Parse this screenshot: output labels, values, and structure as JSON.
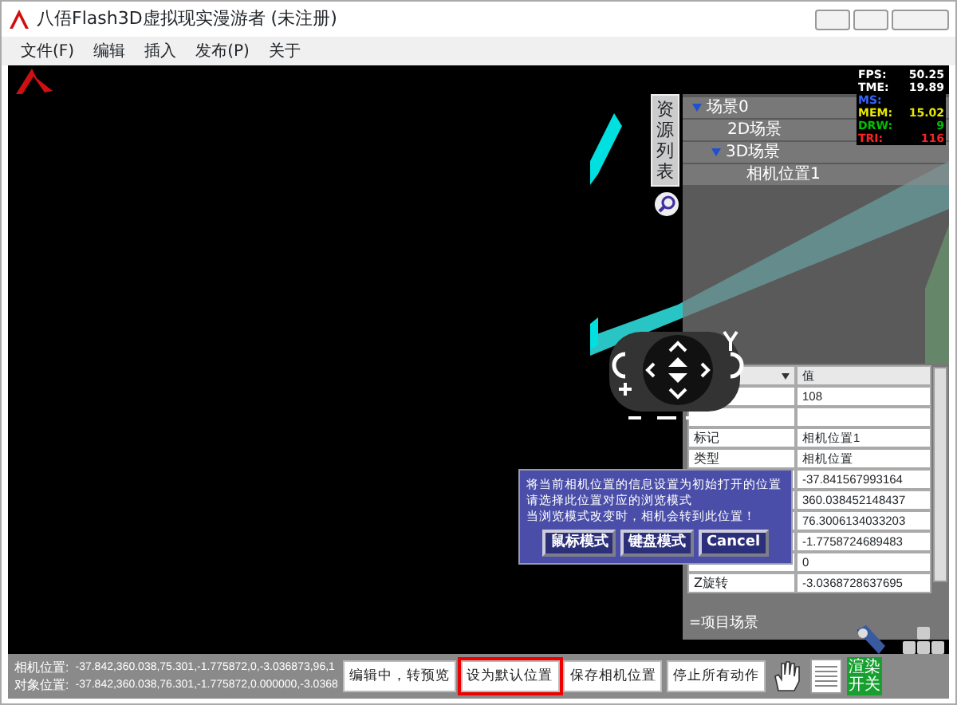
{
  "window": {
    "title": "八俉Flash3D虚拟现实漫游者 (未注册)"
  },
  "menu": [
    "文件(F)",
    "编辑",
    "插入",
    "发布(P)",
    "关于"
  ],
  "stats": [
    {
      "label": "FPS:",
      "value": "50.25",
      "color": "#ffffff"
    },
    {
      "label": "TME:",
      "value": "19.89",
      "color": "#ffffff"
    },
    {
      "label": "MS:",
      "color": "#3366ff"
    },
    {
      "label": "MEM:",
      "value": "15.02",
      "color": "#e8e800"
    },
    {
      "label": "DRW:",
      "value": "9",
      "color": "#00c000"
    },
    {
      "label": "TRI:",
      "value": "116",
      "color": "#ff2020"
    }
  ],
  "resource_tab": "资源列表",
  "tree": [
    {
      "label": "场景0",
      "expanded": true,
      "children": [
        {
          "label": "2D场景"
        },
        {
          "label": "3D场景",
          "expanded": true,
          "children": [
            {
              "label": "相机位置1"
            }
          ]
        }
      ]
    }
  ],
  "properties": {
    "columns": [
      "",
      "值"
    ],
    "rows": [
      {
        "value": "108"
      },
      {},
      {
        "label": "标记",
        "value": "相机位置1"
      },
      {
        "label": "类型",
        "value": "相机位置"
      },
      {
        "value": "-37.841567993164"
      },
      {
        "value": "360.038452148437"
      },
      {
        "value": "76.3006134033203"
      },
      {
        "value": "-1.7758724689483"
      },
      {
        "value": "0"
      },
      {
        "label": "Z旋转",
        "value": "-3.0368728637695"
      }
    ],
    "footer": "=项目场景"
  },
  "dialog": {
    "lines": [
      "将当前相机位置的信息设置为初始打开的位置",
      "请选择此位置对应的浏览模式",
      "当浏览模式改变时，相机会转到此位置！"
    ],
    "buttons": [
      "鼠标模式",
      "键盘模式",
      "Cancel"
    ]
  },
  "positions": [
    {
      "label": "相机位置:",
      "value": "-37.842,360.038,75.301,-1.775872,0,-3.036873,96,1"
    },
    {
      "label": "对象位置:",
      "value": "-37.842,360.038,76.301,-1.775872,0.000000,-3.0368"
    }
  ],
  "buttons": [
    {
      "label": "编辑中，转预览",
      "selected": false
    },
    {
      "label": "设为默认位置",
      "selected": true
    },
    {
      "label": "保存相机位置",
      "selected": false
    },
    {
      "label": "停止所有动作",
      "selected": false
    }
  ],
  "render_switch": {
    "label": "渲染开关",
    "on": true
  }
}
